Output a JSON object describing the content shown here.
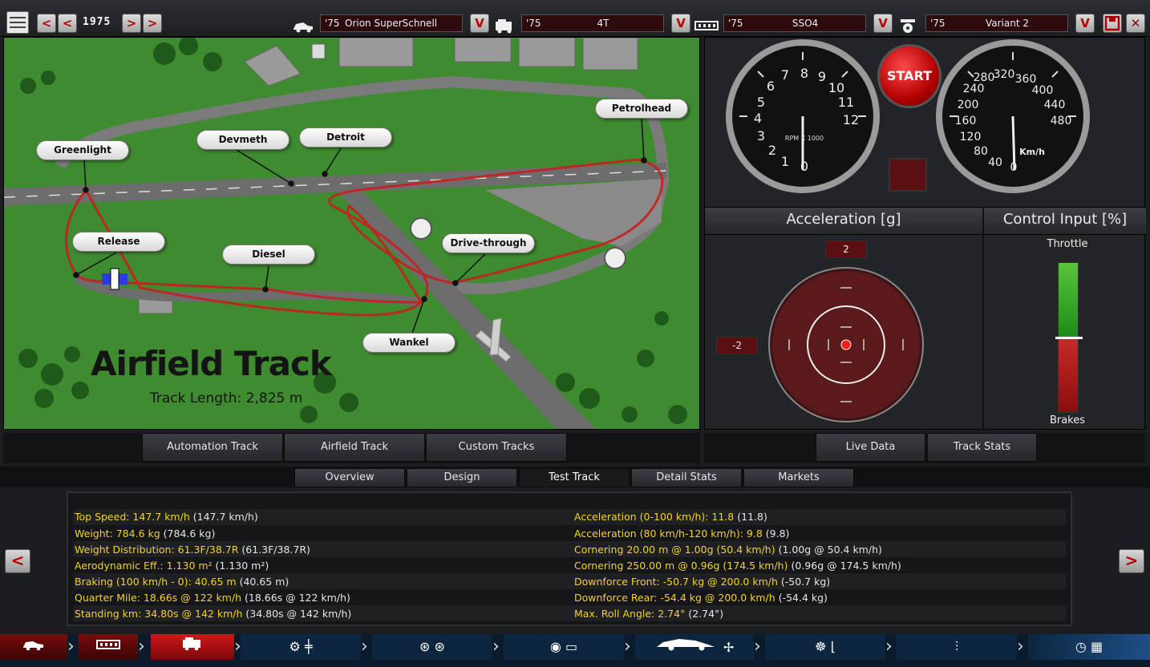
{
  "topbar": {
    "year": "1975",
    "components": [
      {
        "name": "car-icon",
        "year": "'75",
        "label": "Orion SuperSchnell"
      },
      {
        "name": "engine-family-icon",
        "year": "'75",
        "label": "4T"
      },
      {
        "name": "trim-icon",
        "year": "'75",
        "label": "SSO4"
      },
      {
        "name": "engine-variant-icon",
        "year": "'75",
        "label": "Variant 2"
      }
    ]
  },
  "map": {
    "title": "Airfield Track",
    "length": "Track Length: 2,825 m",
    "corners": [
      "Greenlight",
      "Devmeth",
      "Detroit",
      "Petrolhead",
      "Release",
      "Diesel",
      "Drive-through",
      "Wankel"
    ],
    "tabs": [
      "Automation Track",
      "Airfield Track",
      "Custom Tracks"
    ]
  },
  "dash": {
    "start": "START",
    "rpm_label": "RPM X 1000",
    "rpm_ticks": [
      "0",
      "1",
      "2",
      "3",
      "4",
      "5",
      "6",
      "7",
      "8",
      "9",
      "10",
      "11",
      "12"
    ],
    "speed_label": "Km/h",
    "speed_ticks": [
      "0",
      "40",
      "80",
      "120",
      "160",
      "200",
      "240",
      "280",
      "320",
      "360",
      "400",
      "440",
      "480"
    ],
    "accel_title": "Acceleration [g]",
    "control_title": "Control Input [%]",
    "accel_top": "2",
    "accel_left": "-2",
    "throttle": "Throttle",
    "brakes": "Brakes",
    "throttle_fraction": 0.5,
    "tabs": [
      "Live Data",
      "Track Stats"
    ]
  },
  "nav": {
    "tabs": [
      "Overview",
      "Design",
      "Test Track",
      "Detail Stats",
      "Markets"
    ],
    "active": "Test Track"
  },
  "stats": {
    "left": [
      {
        "k": "Top Speed: 147.7 km/h",
        "v": "(147.7 km/h)"
      },
      {
        "k": "Weight: 784.6 kg",
        "v": "(784.6 kg)"
      },
      {
        "k": "Weight Distribution: 61.3F/38.7R",
        "v": "(61.3F/38.7R)"
      },
      {
        "k": "Aerodynamic Eff.: 1.130 m²",
        "v": "(1.130 m²)"
      },
      {
        "k": "Braking (100 km/h - 0): 40.65 m",
        "v": "(40.65 m)"
      },
      {
        "k": "Quarter Mile: 18.66s @ 122 km/h",
        "v": "(18.66s @ 122 km/h)"
      },
      {
        "k": "Standing km: 34.80s @ 142 km/h",
        "v": "(34.80s @ 142 km/h)"
      }
    ],
    "right": [
      {
        "k": "Acceleration (0-100 km/h): 11.8",
        "v": "(11.8)"
      },
      {
        "k": "Acceleration (80 km/h-120 km/h): 9.8",
        "v": "(9.8)"
      },
      {
        "k": "Cornering 20.00 m @ 1.00g (50.4 km/h)",
        "v": "(1.00g @ 50.4 km/h)"
      },
      {
        "k": "Cornering 250.00 m @ 0.96g (174.5 km/h)",
        "v": "(0.96g @ 174.5 km/h)"
      },
      {
        "k": "Downforce Front: -50.7 kg @ 200.0 km/h",
        "v": "(-50.7 kg)"
      },
      {
        "k": "Downforce Rear: -54.4 kg @ 200.0 km/h",
        "v": "(-54.4 kg)"
      },
      {
        "k": "Max. Roll Angle: 2.74°",
        "v": "(2.74°)"
      }
    ]
  },
  "colors": {
    "accent": "#c40000",
    "stat_key": "#f4d41e",
    "grass": "#3f8b30"
  }
}
